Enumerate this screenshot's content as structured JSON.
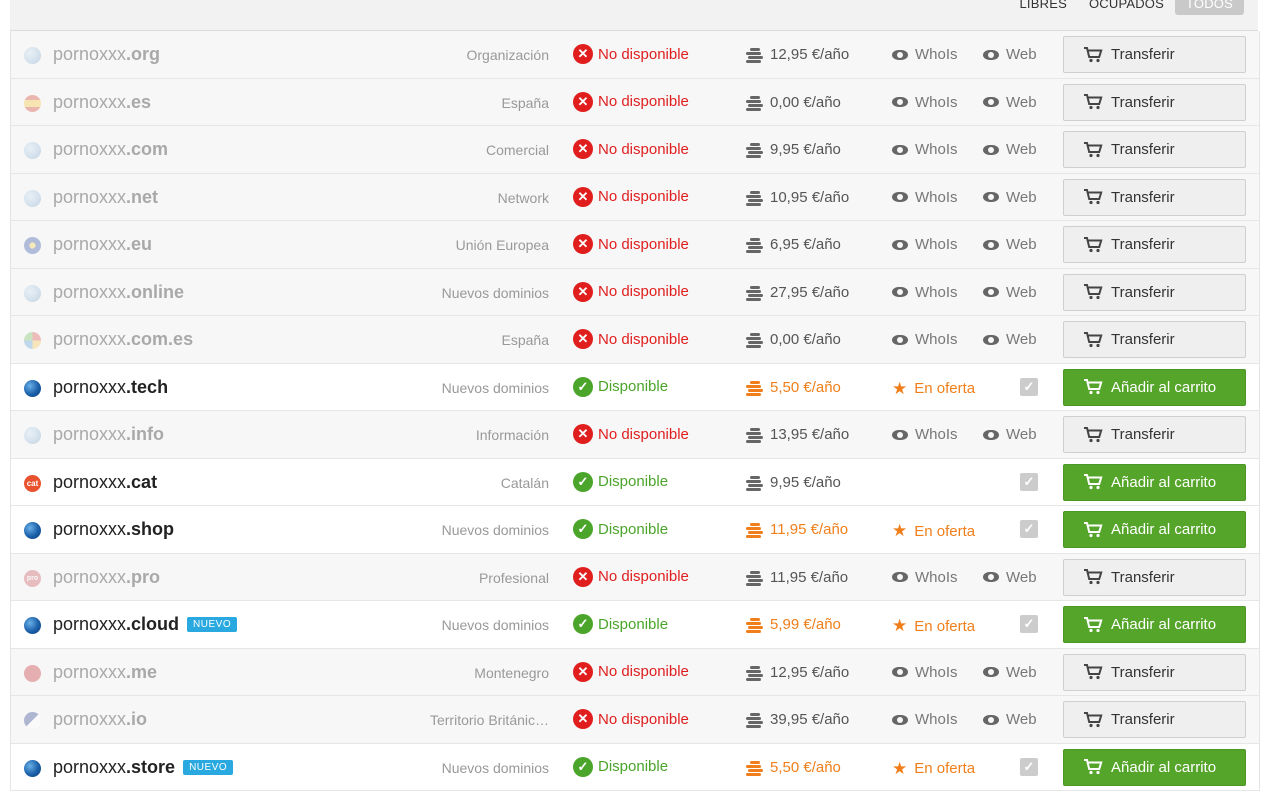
{
  "filters": [
    "LIBRES",
    "OCUPADOS",
    "TODOS"
  ],
  "active_filter": "TODOS",
  "labels": {
    "unavailable": "No disponible",
    "available": "Disponible",
    "whois": "WhoIs",
    "web": "Web",
    "offer": "En oferta",
    "transfer": "Transferir",
    "add_to_cart": "Añadir al carrito",
    "new_badge": "NUEVO"
  },
  "colors": {
    "available": "#4aa52a",
    "unavailable": "#e01e1e",
    "offer": "#f07f1b",
    "button_green": "#55a52a",
    "badge": "#29a9e0"
  },
  "rows": [
    {
      "name": "pornoxxx",
      "tld": ".org",
      "category": "Organización",
      "available": false,
      "price": "12,95 €/año",
      "offer": false,
      "icon": "globe-gray"
    },
    {
      "name": "pornoxxx",
      "tld": ".es",
      "category": "España",
      "available": false,
      "price": "0,00 €/año",
      "offer": false,
      "icon": "flag-es"
    },
    {
      "name": "pornoxxx",
      "tld": ".com",
      "category": "Comercial",
      "available": false,
      "price": "9,95 €/año",
      "offer": false,
      "icon": "globe-gray"
    },
    {
      "name": "pornoxxx",
      "tld": ".net",
      "category": "Network",
      "available": false,
      "price": "10,95 €/año",
      "offer": false,
      "icon": "globe-gray"
    },
    {
      "name": "pornoxxx",
      "tld": ".eu",
      "category": "Unión Europea",
      "available": false,
      "price": "6,95 €/año",
      "offer": false,
      "icon": "flag-eu"
    },
    {
      "name": "pornoxxx",
      "tld": ".online",
      "category": "Nuevos dominios",
      "available": false,
      "price": "27,95 €/año",
      "offer": false,
      "icon": "globe-gray"
    },
    {
      "name": "pornoxxx",
      "tld": ".com.es",
      "category": "España",
      "available": false,
      "price": "0,00 €/año",
      "offer": false,
      "icon": "flag-mix"
    },
    {
      "name": "pornoxxx",
      "tld": ".tech",
      "category": "Nuevos dominios",
      "available": true,
      "price": "5,50 €/año",
      "offer": true,
      "icon": "globe"
    },
    {
      "name": "pornoxxx",
      "tld": ".info",
      "category": "Información",
      "available": false,
      "price": "13,95 €/año",
      "offer": false,
      "icon": "globe-gray"
    },
    {
      "name": "pornoxxx",
      "tld": ".cat",
      "category": "Catalán",
      "available": true,
      "price": "9,95 €/año",
      "offer": false,
      "icon": "flag-cat",
      "icon_text": "cat"
    },
    {
      "name": "pornoxxx",
      "tld": ".shop",
      "category": "Nuevos dominios",
      "available": true,
      "price": "11,95 €/año",
      "offer": true,
      "icon": "globe"
    },
    {
      "name": "pornoxxx",
      "tld": ".pro",
      "category": "Profesional",
      "available": false,
      "price": "11,95 €/año",
      "offer": false,
      "icon": "flag-pro",
      "icon_text": "pro"
    },
    {
      "name": "pornoxxx",
      "tld": ".cloud",
      "category": "Nuevos dominios",
      "available": true,
      "price": "5,99 €/año",
      "offer": true,
      "icon": "globe",
      "new": true
    },
    {
      "name": "pornoxxx",
      "tld": ".me",
      "category": "Montenegro",
      "available": false,
      "price": "12,95 €/año",
      "offer": false,
      "icon": "flag-me"
    },
    {
      "name": "pornoxxx",
      "tld": ".io",
      "category": "Territorio Británic…",
      "available": false,
      "price": "39,95 €/año",
      "offer": false,
      "icon": "flag-io"
    },
    {
      "name": "pornoxxx",
      "tld": ".store",
      "category": "Nuevos dominios",
      "available": true,
      "price": "5,50 €/año",
      "offer": true,
      "icon": "globe",
      "new": true
    }
  ]
}
